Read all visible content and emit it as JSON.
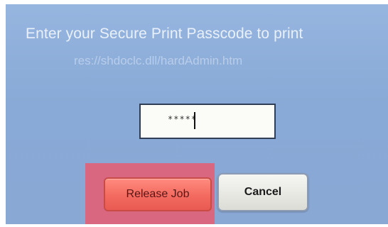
{
  "screen": {
    "title": "Enter your Secure Print Passcode to print",
    "url": "res://shdoclc.dll/hardAdmin.htm"
  },
  "passcode": {
    "value": "*****"
  },
  "buttons": {
    "release_label": "Release Job",
    "cancel_label": "Cancel"
  },
  "colors": {
    "screen_background": "#8aa9d6",
    "release_button": "#f36a5f",
    "highlight": "#d8677f",
    "cancel_button": "#e7e7e2"
  }
}
